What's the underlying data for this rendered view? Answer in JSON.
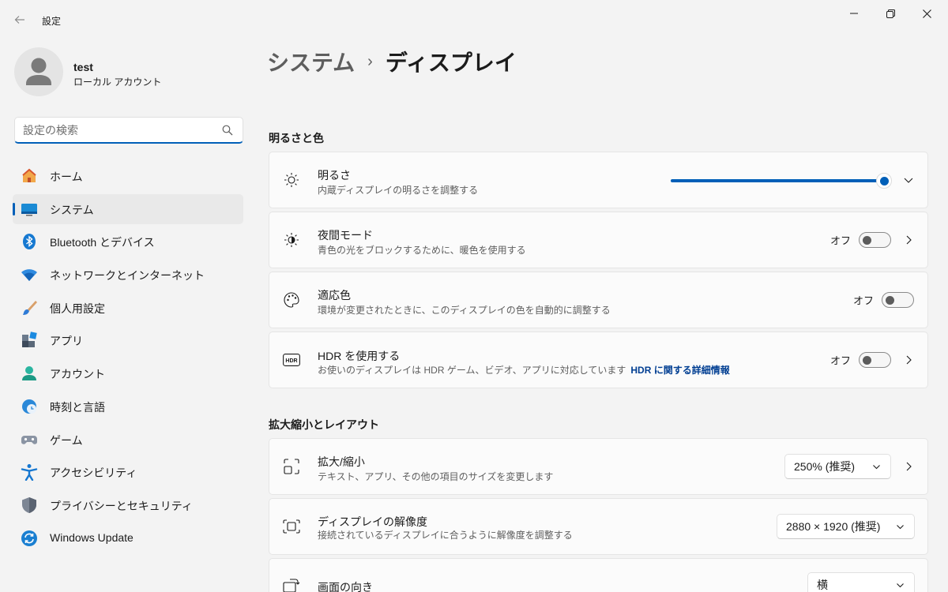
{
  "window": {
    "title": "設定",
    "back_icon": "back-arrow-icon",
    "minimize_icon": "minimize-icon",
    "maximize_icon": "restore-icon",
    "close_icon": "close-icon"
  },
  "profile": {
    "name": "test",
    "account_type": "ローカル アカウント"
  },
  "search": {
    "placeholder": "設定の検索",
    "value": ""
  },
  "sidebar": {
    "items": [
      {
        "label": "ホーム",
        "icon": "home-icon",
        "active": false
      },
      {
        "label": "システム",
        "icon": "system-icon",
        "active": true
      },
      {
        "label": "Bluetooth とデバイス",
        "icon": "bluetooth-icon",
        "active": false
      },
      {
        "label": "ネットワークとインターネット",
        "icon": "wifi-icon",
        "active": false
      },
      {
        "label": "個人用設定",
        "icon": "brush-icon",
        "active": false
      },
      {
        "label": "アプリ",
        "icon": "apps-icon",
        "active": false
      },
      {
        "label": "アカウント",
        "icon": "account-icon",
        "active": false
      },
      {
        "label": "時刻と言語",
        "icon": "time-language-icon",
        "active": false
      },
      {
        "label": "ゲーム",
        "icon": "gaming-icon",
        "active": false
      },
      {
        "label": "アクセシビリティ",
        "icon": "accessibility-icon",
        "active": false
      },
      {
        "label": "プライバシーとセキュリティ",
        "icon": "shield-icon",
        "active": false
      },
      {
        "label": "Windows Update",
        "icon": "windows-update-icon",
        "active": false
      }
    ]
  },
  "breadcrumb": {
    "parent": "システム",
    "separator": "›",
    "current": "ディスプレイ"
  },
  "sections": {
    "brightness_color": {
      "title": "明るさと色",
      "brightness": {
        "title": "明るさ",
        "subtitle": "内蔵ディスプレイの明るさを調整する",
        "level_percent": 100,
        "icon": "sun-icon"
      },
      "night_light": {
        "title": "夜間モード",
        "subtitle": "青色の光をブロックするために、暖色を使用する",
        "state": "オフ",
        "icon": "night-light-icon"
      },
      "adaptive_color": {
        "title": "適応色",
        "subtitle": "環境が変更されたときに、このディスプレイの色を自動的に調整する",
        "state": "オフ",
        "icon": "palette-icon"
      },
      "hdr": {
        "title": "HDR を使用する",
        "subtitle": "お使いのディスプレイは HDR ゲーム、ビデオ、アプリに対応しています",
        "link": "HDR に関する詳細情報",
        "state": "オフ",
        "icon": "hdr-icon"
      }
    },
    "scale_layout": {
      "title": "拡大縮小とレイアウト",
      "scale": {
        "title": "拡大/縮小",
        "subtitle": "テキスト、アプリ、その他の項目のサイズを変更します",
        "value": "250% (推奨)",
        "icon": "scale-icon"
      },
      "resolution": {
        "title": "ディスプレイの解像度",
        "subtitle": "接続されているディスプレイに合うように解像度を調整する",
        "value": "2880 × 1920 (推奨)",
        "icon": "resolution-icon"
      },
      "orientation": {
        "title": "画面の向き",
        "value": "横",
        "icon": "orientation-icon"
      }
    }
  },
  "colors": {
    "accent": "#005fb8",
    "link": "#003e92",
    "background": "#f3f3f3",
    "card": "#fbfbfb"
  }
}
